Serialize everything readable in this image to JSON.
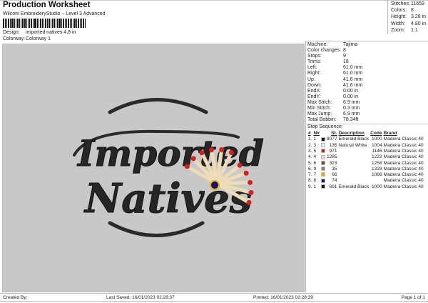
{
  "header": {
    "title": "Production Worksheet",
    "subtitle": "Wilcom EmbroideryStudio – Level 3 Advanced",
    "design_label": "Design:",
    "design_value": "imported natives 4,8 in",
    "colorway_label": "Colorway:",
    "colorway_value": "Colorway 1"
  },
  "stats": [
    {
      "k": "Stitches:",
      "v": "11659"
    },
    {
      "k": "Colors:",
      "v": "8"
    },
    {
      "k": "Height:",
      "v": "3.28 in"
    },
    {
      "k": "Width:",
      "v": "4.80 in"
    },
    {
      "k": "Zoom:",
      "v": "1:1"
    }
  ],
  "design_art": {
    "line1": "Imported",
    "line2": "Natives"
  },
  "machine": [
    {
      "k": "Machine:",
      "v": "Tajima"
    },
    {
      "k": "Color changes:",
      "v": "8"
    },
    {
      "k": "Stops:",
      "v": "9"
    },
    {
      "k": "Trims:",
      "v": "18"
    },
    {
      "k": "Left:",
      "v": "61.0 mm"
    },
    {
      "k": "Right:",
      "v": "61.0 mm"
    },
    {
      "k": "Up:",
      "v": "41.6 mm"
    },
    {
      "k": "Down:",
      "v": "41.6 mm"
    },
    {
      "k": "EndX:",
      "v": "0.00 in"
    },
    {
      "k": "EndY:",
      "v": "0.00 in"
    },
    {
      "k": "Max Stitch:",
      "v": "6.9 mm"
    },
    {
      "k": "Min Stitch:",
      "v": "0.3 mm"
    },
    {
      "k": "Max Jump:",
      "v": "6.9 mm"
    },
    {
      "k": "Total Bobbin:",
      "v": "78.34ft"
    }
  ],
  "stop_sequence": {
    "label": "Stop Sequence:",
    "headers": [
      "#",
      "N#",
      "",
      "St.",
      "Description",
      "Code",
      "Brand"
    ],
    "rows": [
      {
        "i": "1.",
        "n": "1",
        "color": "#111111",
        "st": "8077",
        "desc": "Emerald Black",
        "code": "1000",
        "brand": "Madeira Classic 40"
      },
      {
        "i": "2.",
        "n": "3",
        "color": "#e8e8ee",
        "st": "135",
        "desc": "Natural White",
        "code": "1004",
        "brand": "Madeira Classic 40"
      },
      {
        "i": "3.",
        "n": "5",
        "color": "#d42020",
        "st": "971",
        "desc": "",
        "code": "1146",
        "brand": "Madeira Classic 40"
      },
      {
        "i": "4.",
        "n": "4",
        "color": "#eedcb8",
        "st": "1285",
        "desc": "",
        "code": "1222",
        "brand": "Madeira Classic 40"
      },
      {
        "i": "5.",
        "n": "6",
        "color": "#7a4a32",
        "st": "323",
        "desc": "",
        "code": "1258",
        "brand": "Madeira Classic 40"
      },
      {
        "i": "6.",
        "n": "9",
        "color": "#9a7a6a",
        "st": "35",
        "desc": "",
        "code": "1328",
        "brand": "Madeira Classic 40"
      },
      {
        "i": "7.",
        "n": "7",
        "color": "#f0b000",
        "st": "66",
        "desc": "",
        "code": "1068",
        "brand": "Madeira Classic 40"
      },
      {
        "i": "8.",
        "n": "8",
        "color": "#101080",
        "st": "74",
        "desc": "",
        "code": "",
        "brand": "Madeira Classic 40"
      },
      {
        "i": "9.",
        "n": "1",
        "color": "#111111",
        "st": "691",
        "desc": "Emerald Black",
        "code": "1000",
        "brand": "Madeira Classic 40"
      }
    ]
  },
  "footer": {
    "created": "Created By:",
    "saved": "Last Saved: 16/01/2023 02:28:37",
    "printed": "Printed: 16/01/2023 02:28:39",
    "page": "Page 1 of 1"
  }
}
